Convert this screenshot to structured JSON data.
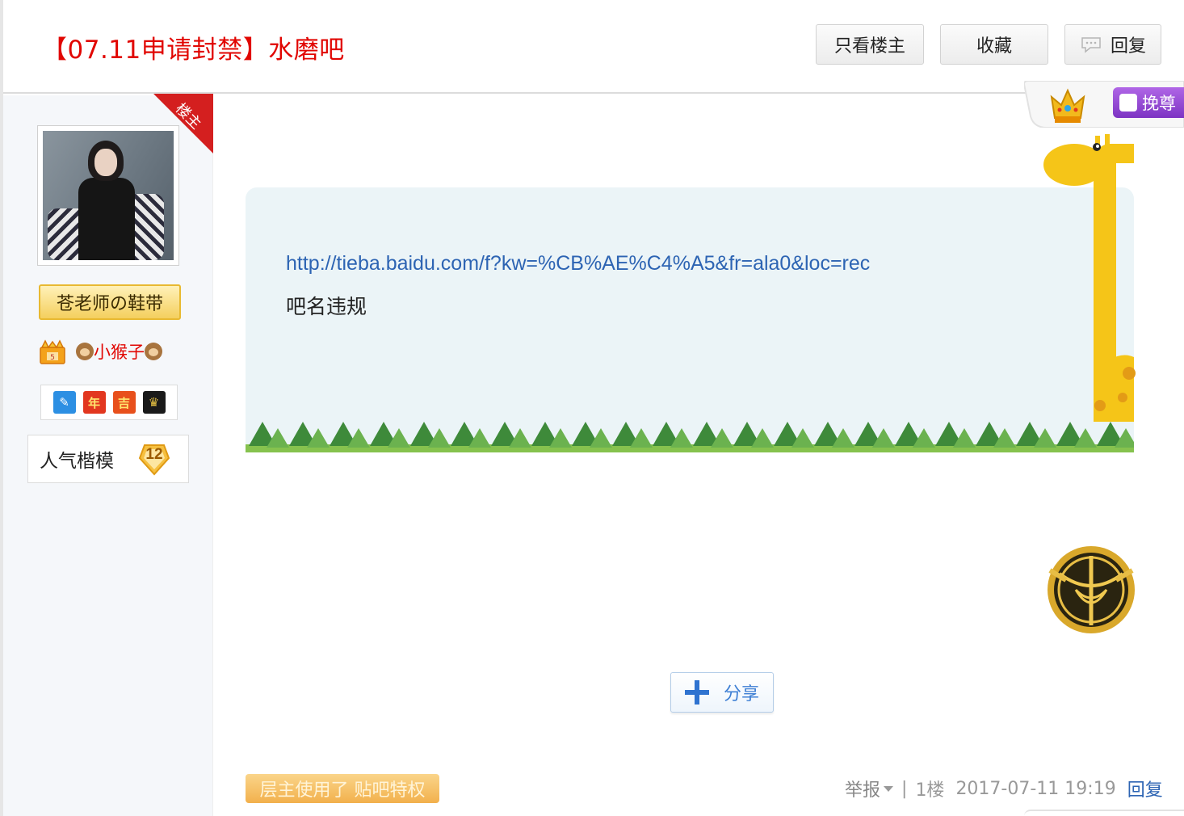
{
  "header": {
    "title": "【07.11申请封禁】水磨吧",
    "buttons": {
      "only_op": "只看楼主",
      "favorite": "收藏",
      "reply": "回复"
    }
  },
  "user": {
    "op_ribbon": "楼主",
    "badge_name": "苍老师の鞋带",
    "nickname": "小猴子",
    "icons": [
      "magic-wand-icon",
      "year-icon",
      "luck-icon",
      "lion-shield-icon"
    ],
    "icon_texts": [
      "",
      "年",
      "吉",
      ""
    ],
    "popularity_label": "人气楷模",
    "popularity_level": "12"
  },
  "deco": {
    "vip_text": "挽尊"
  },
  "post": {
    "link": "http://tieba.baidu.com/f?kw=%CB%AE%C4%A5&fr=ala0&loc=rec",
    "text": "吧名违规"
  },
  "share_label": "分享",
  "privilege_label": "层主使用了 贴吧特权",
  "footer": {
    "report": "举报",
    "floor": "1楼",
    "time": "2017-07-11 19:19",
    "reply": "回复"
  },
  "colors": {
    "title": "#e10602",
    "link": "#2d64b3",
    "card_bg": "#ebf4f7",
    "grass": "#5aa347"
  }
}
